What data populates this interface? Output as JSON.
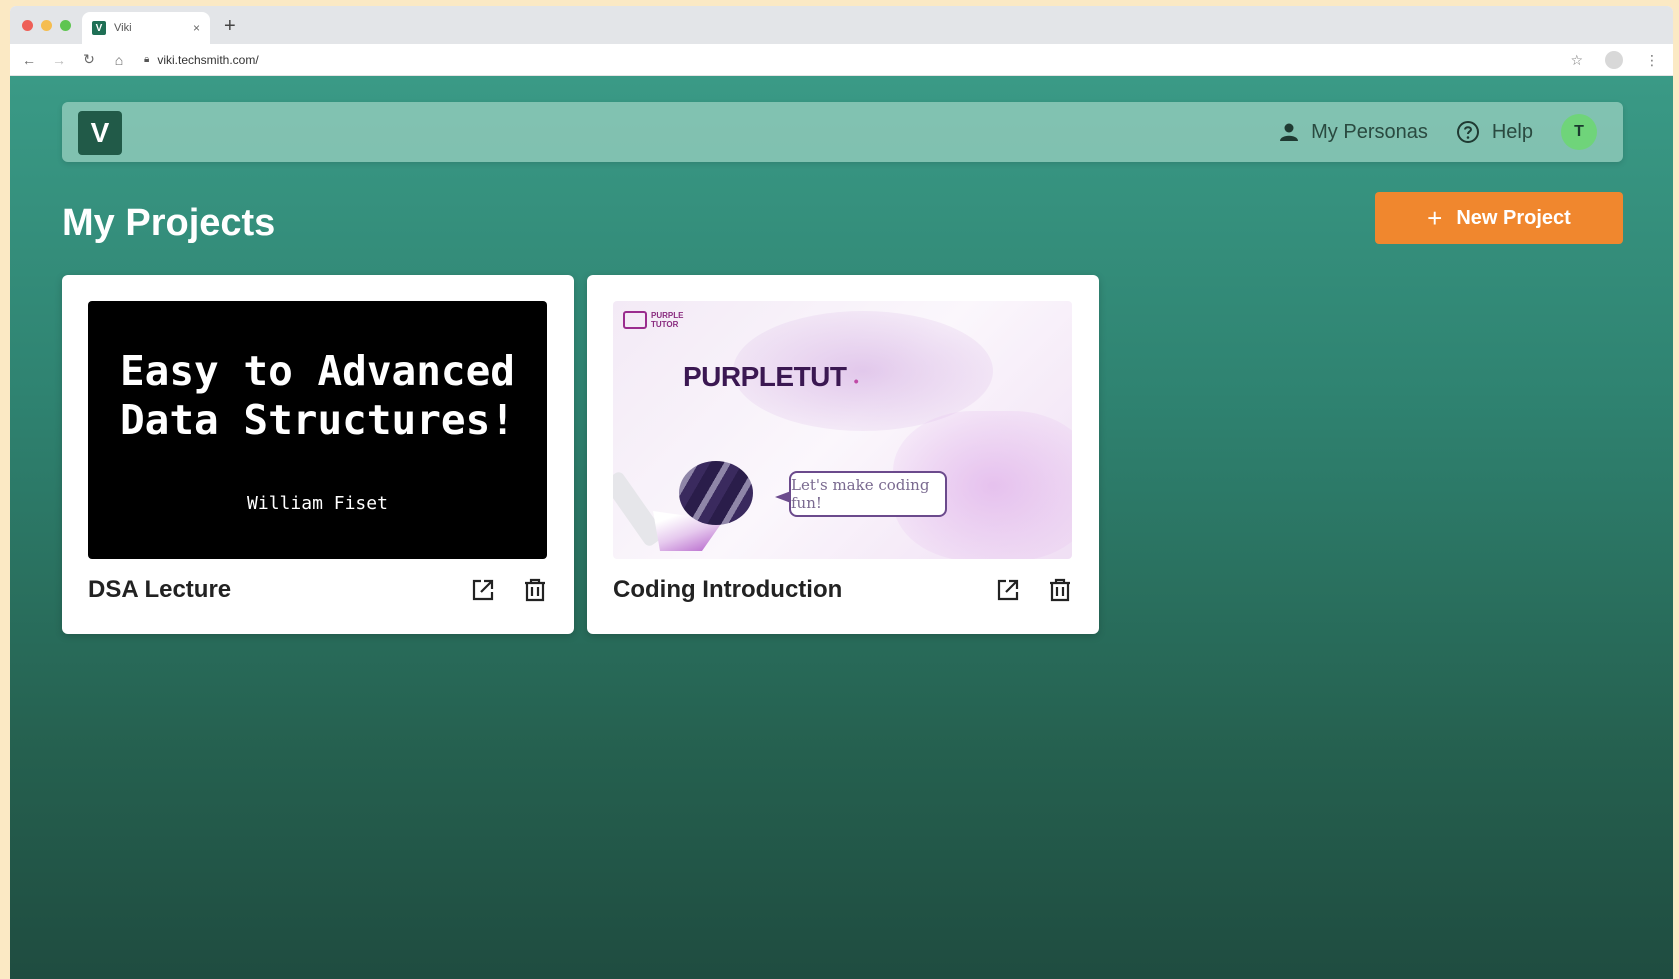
{
  "browser": {
    "tab_title": "Viki",
    "tab_favicon": "V",
    "tab_close": "×",
    "new_tab": "+",
    "url": "viki.techsmith.com/"
  },
  "header": {
    "logo_letter": "V",
    "personas_label": "My Personas",
    "help_label": "Help",
    "avatar_initial": "T"
  },
  "page": {
    "title": "My Projects",
    "new_project_label": "New Project"
  },
  "projects": [
    {
      "name": "DSA Lecture",
      "thumb_title": "Easy to Advanced\nData Structures!",
      "thumb_author": "William Fiset"
    },
    {
      "name": "Coding Introduction",
      "thumb_logo_text": "PURPLE\nTUTOR",
      "thumb_brand": "PURPLETUT",
      "thumb_bubble": "Let's make coding fun!"
    }
  ],
  "colors": {
    "accent": "#f0872e",
    "brand": "#215a48",
    "avatar": "#6fd47a"
  }
}
